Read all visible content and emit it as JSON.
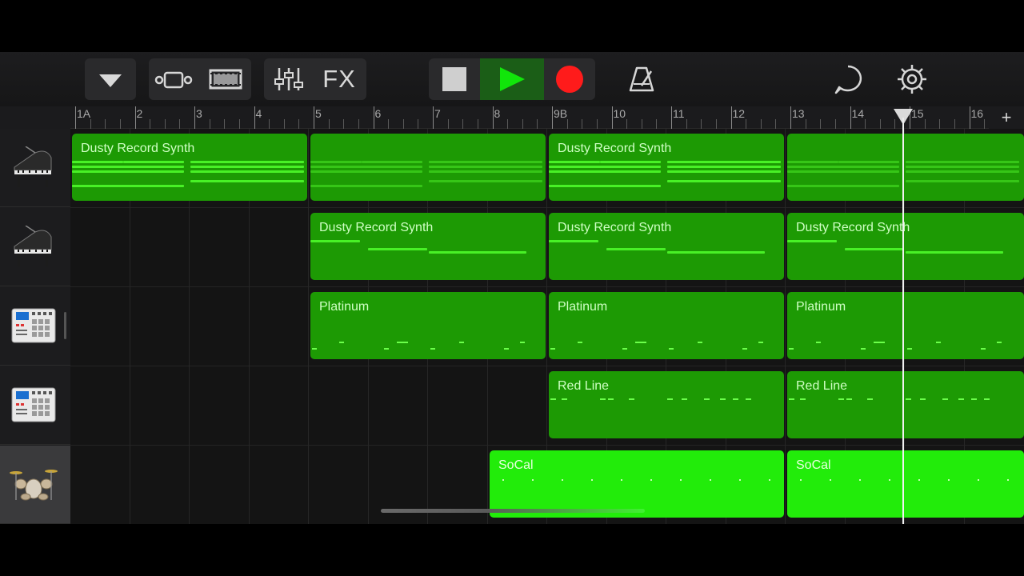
{
  "toolbar": {
    "fx_label": "FX",
    "icons": [
      "dropdown-icon",
      "tracks-view-icon",
      "browser-icon",
      "mixer-icon",
      "stop-icon",
      "play-icon",
      "record-icon",
      "metronome-icon",
      "loop-icon",
      "settings-icon"
    ],
    "colors": {
      "play": "#11e60a",
      "record": "#ff1b1b",
      "stop": "#d0d0d0"
    }
  },
  "ruler": {
    "bars": [
      "1A",
      "2",
      "3",
      "4",
      "5",
      "6",
      "7",
      "8",
      "9B",
      "10",
      "11",
      "12",
      "13",
      "14",
      "15",
      "16"
    ],
    "add_label": "+"
  },
  "tracks": [
    {
      "instrument": "grand-piano-icon",
      "regions": [
        {
          "title": "Dusty Record Synth"
        },
        {
          "title": ""
        },
        {
          "title": "Dusty Record Synth"
        },
        {
          "title": ""
        }
      ]
    },
    {
      "instrument": "grand-piano-icon",
      "regions": [
        {
          "title": "Dusty Record Synth"
        },
        {
          "title": "Dusty Record Synth"
        },
        {
          "title": "Dusty Record Synth"
        }
      ]
    },
    {
      "instrument": "drum-machine-icon",
      "regions": [
        {
          "title": "Platinum"
        },
        {
          "title": "Platinum"
        },
        {
          "title": "Platinum"
        }
      ]
    },
    {
      "instrument": "drum-machine-icon",
      "regions": [
        {
          "title": "Red Line"
        },
        {
          "title": "Red Line"
        }
      ]
    },
    {
      "instrument": "drum-kit-icon",
      "selected": true,
      "regions": [
        {
          "title": "SoCal"
        },
        {
          "title": "SoCal"
        }
      ]
    }
  ],
  "colors": {
    "region": "#1d9a04",
    "region_selected": "#22ec0a",
    "note": "#48f126"
  }
}
